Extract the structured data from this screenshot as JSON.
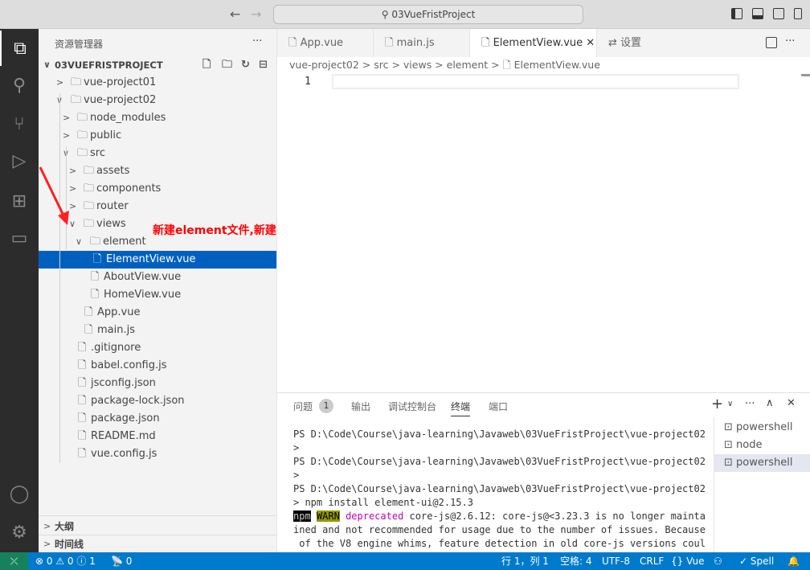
{
  "titlebar": {
    "search": "03VueFristProject",
    "back": "←",
    "forward": "→"
  },
  "sidebar": {
    "title": "资源管理器",
    "more": "···",
    "root": "03VUEFRISTPROJECT",
    "tree": [
      {
        "label": "vue-project01",
        "level": 1,
        "type": "folder",
        "open": false
      },
      {
        "label": "vue-project02",
        "level": 1,
        "type": "folder",
        "open": true
      },
      {
        "label": "node_modules",
        "level": 2,
        "type": "folder",
        "open": false
      },
      {
        "label": "public",
        "level": 2,
        "type": "folder",
        "open": false
      },
      {
        "label": "src",
        "level": 2,
        "type": "folder",
        "open": true
      },
      {
        "label": "assets",
        "level": 3,
        "type": "folder",
        "open": false
      },
      {
        "label": "components",
        "level": 3,
        "type": "folder",
        "open": false
      },
      {
        "label": "router",
        "level": 3,
        "type": "folder",
        "open": false
      },
      {
        "label": "views",
        "level": 3,
        "type": "folder",
        "open": true
      },
      {
        "label": "element",
        "level": 4,
        "type": "folder",
        "open": true
      },
      {
        "label": "ElementView.vue",
        "level": 5,
        "type": "file",
        "selected": true
      },
      {
        "label": "AboutView.vue",
        "level": 4,
        "type": "file"
      },
      {
        "label": "HomeView.vue",
        "level": 4,
        "type": "file"
      },
      {
        "label": "App.vue",
        "level": 3,
        "type": "file"
      },
      {
        "label": "main.js",
        "level": 3,
        "type": "file"
      },
      {
        "label": ".gitignore",
        "level": 2,
        "type": "file"
      },
      {
        "label": "babel.config.js",
        "level": 2,
        "type": "file"
      },
      {
        "label": "jsconfig.json",
        "level": 2,
        "type": "file"
      },
      {
        "label": "package-lock.json",
        "level": 2,
        "type": "file"
      },
      {
        "label": "package.json",
        "level": 2,
        "type": "file"
      },
      {
        "label": "README.md",
        "level": 2,
        "type": "file"
      },
      {
        "label": "vue.config.js",
        "level": 2,
        "type": "file"
      }
    ],
    "outline": "大纲",
    "timeline": "时间线"
  },
  "annotation": {
    "text": "新建element文件,新建ElementView.vue",
    "color": "#ff0000"
  },
  "tabs": [
    {
      "label": "App.vue"
    },
    {
      "label": "main.js"
    },
    {
      "label": "ElementView.vue",
      "active": true
    },
    {
      "label": "设置"
    }
  ],
  "breadcrumb": [
    "vue-project02",
    "src",
    "views",
    "element",
    "ElementView.vue"
  ],
  "editor": {
    "line": "1"
  },
  "panel": {
    "tabs": [
      "问题",
      "输出",
      "调试控制台",
      "终端",
      "端口"
    ],
    "problems_count": "1",
    "terminal": [
      "PS D:\\Code\\Course\\java-learning\\Javaweb\\03VueFristProject\\vue-project02",
      ">",
      "PS D:\\Code\\Course\\java-learning\\Javaweb\\03VueFristProject\\vue-project02",
      ">",
      "PS D:\\Code\\Course\\java-learning\\Javaweb\\03VueFristProject\\vue-project02",
      "> npm install element-ui@2.15.3"
    ],
    "warn": {
      "npm": "npm",
      "warn": "WARN",
      "dep": "deprecated",
      "rest": " core-js@2.6.12: core-js@<3.23.3 is no longer mainta",
      "l2": "ined and not recommended for usage due to the number of issues. Because",
      "l3": " of the V8 engine whims, feature detection in old core-js versions coul"
    },
    "terminals": [
      "powershell",
      "node",
      "powershell"
    ]
  },
  "status": {
    "errors": "0",
    "warnings": "0",
    "info": "1",
    "ports": "0",
    "position": "行 1，列 1",
    "spaces": "空格: 4",
    "encoding": "UTF-8",
    "eol": "CRLF",
    "lang": "Vue",
    "spell": "✓ Spell"
  },
  "colors": {
    "accent": "#007acc",
    "selection": "#0060c0",
    "remote": "#16825d"
  }
}
